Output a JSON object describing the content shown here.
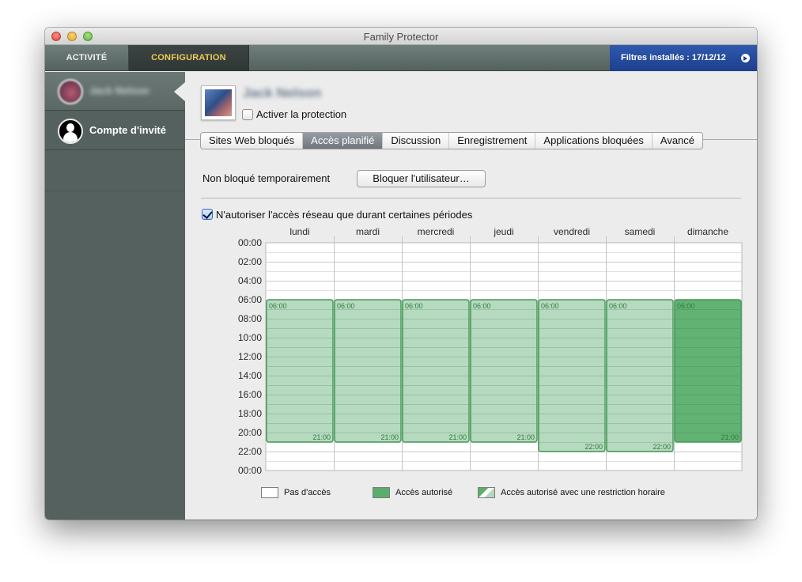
{
  "window": {
    "title": "Family Protector"
  },
  "topbar": {
    "tabs": [
      {
        "label": "ACTIVITÉ"
      },
      {
        "label": "CONFIGURATION"
      }
    ],
    "filters_label": "Filtres installés : 17/12/12"
  },
  "sidebar": {
    "items": [
      {
        "label": "Jack Nelson",
        "icon": "user-photo-avatar"
      },
      {
        "label": "Compte d'invité",
        "icon": "guest-user-icon"
      }
    ]
  },
  "user": {
    "name": "Jack Nelson",
    "protection_label": "Activer la protection",
    "protection_checked": false
  },
  "tabs": [
    {
      "label": "Sites Web bloqués"
    },
    {
      "label": "Accès planifié"
    },
    {
      "label": "Discussion"
    },
    {
      "label": "Enregistrement"
    },
    {
      "label": "Applications bloquées"
    },
    {
      "label": "Avancé"
    }
  ],
  "active_tab": "Accès planifié",
  "status": {
    "label": "Non bloqué temporairement",
    "block_button": "Bloquer l'utilisateur…"
  },
  "restrict": {
    "label": "N'autoriser l'accès réseau que durant certaines périodes",
    "checked": true
  },
  "legend": {
    "none": "Pas d'accès",
    "allowed": "Accès autorisé",
    "restricted": "Accès autorisé avec une restriction horaire"
  },
  "colors": {
    "allowed_fill": "#5aae6c",
    "restricted_fill": "#b3d9bc",
    "block_border": "#3f9551",
    "time_text": "#2f7a3f"
  },
  "chart_data": {
    "type": "heatmap",
    "days": [
      "lundi",
      "mardi",
      "mercredi",
      "jeudi",
      "vendredi",
      "samedi",
      "dimanche"
    ],
    "hour_ticks": [
      "00:00",
      "02:00",
      "04:00",
      "06:00",
      "08:00",
      "10:00",
      "12:00",
      "14:00",
      "16:00",
      "18:00",
      "20:00",
      "22:00",
      "00:00"
    ],
    "hour_range": [
      0,
      24
    ],
    "grid": true,
    "blocks": [
      {
        "day": "lundi",
        "start": 6,
        "end": 21,
        "start_label": "06:00",
        "end_label": "21:00",
        "kind": "restricted"
      },
      {
        "day": "mardi",
        "start": 6,
        "end": 21,
        "start_label": "06:00",
        "end_label": "21:00",
        "kind": "restricted"
      },
      {
        "day": "mercredi",
        "start": 6,
        "end": 21,
        "start_label": "06:00",
        "end_label": "21:00",
        "kind": "restricted"
      },
      {
        "day": "jeudi",
        "start": 6,
        "end": 21,
        "start_label": "06:00",
        "end_label": "21:00",
        "kind": "restricted"
      },
      {
        "day": "vendredi",
        "start": 6,
        "end": 22,
        "start_label": "06:00",
        "end_label": "22:00",
        "kind": "restricted"
      },
      {
        "day": "samedi",
        "start": 6,
        "end": 22,
        "start_label": "06:00",
        "end_label": "22:00",
        "kind": "restricted"
      },
      {
        "day": "dimanche",
        "start": 6,
        "end": 21,
        "start_label": "06:00",
        "end_label": "21:00",
        "kind": "allowed"
      }
    ]
  }
}
